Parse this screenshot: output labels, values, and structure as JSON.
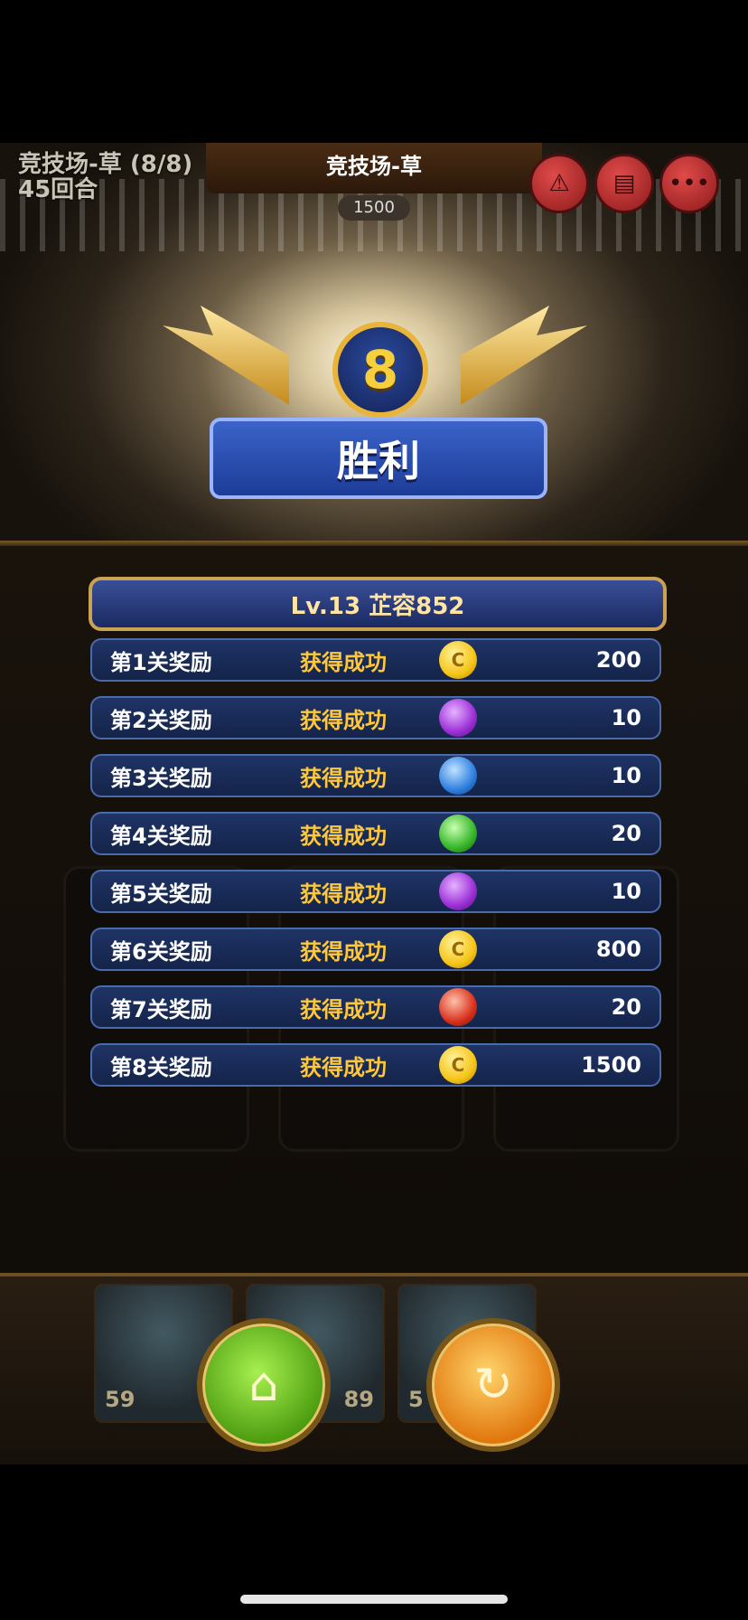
{
  "hud": {
    "stage_name": "竞技场-草 (8/8)",
    "rounds": "45回合",
    "title": "竞技场-草",
    "score": "1500",
    "buttons": [
      {
        "icon": "triangle-icon",
        "glyph": "⚠"
      },
      {
        "icon": "scroll-icon",
        "glyph": "▤"
      },
      {
        "icon": "more-icon",
        "glyph": "•••"
      }
    ]
  },
  "victory": {
    "rank": "8",
    "label": "胜利"
  },
  "result_panel": {
    "header": "Lv.13  芷容852",
    "rewards": [
      {
        "label": "第1关奖励",
        "status": "获得成功",
        "icon": "gold-coin-icon",
        "color": "#f5c518",
        "amount": "200"
      },
      {
        "label": "第2关奖励",
        "status": "获得成功",
        "icon": "purple-orb-icon",
        "color": "#9b2fd6",
        "amount": "10"
      },
      {
        "label": "第3关奖励",
        "status": "获得成功",
        "icon": "blue-drop-icon",
        "color": "#2f7fe0",
        "amount": "10"
      },
      {
        "label": "第4关奖励",
        "status": "获得成功",
        "icon": "green-orb-icon",
        "color": "#37b62a",
        "amount": "20"
      },
      {
        "label": "第5关奖励",
        "status": "获得成功",
        "icon": "purple-orb-icon",
        "color": "#9b2fd6",
        "amount": "10"
      },
      {
        "label": "第6关奖励",
        "status": "获得成功",
        "icon": "gold-coin-icon",
        "color": "#f5c518",
        "amount": "800"
      },
      {
        "label": "第7关奖励",
        "status": "获得成功",
        "icon": "red-orb-icon",
        "color": "#d8321e",
        "amount": "20"
      },
      {
        "label": "第8关奖励",
        "status": "获得成功",
        "icon": "gold-coin-icon",
        "color": "#f5c518",
        "amount": "1500"
      }
    ]
  },
  "bottom": {
    "hero_levels": [
      "59",
      "89",
      "5"
    ],
    "home_glyph": "⌂",
    "retry_glyph": "↻"
  },
  "colors": {
    "accent_gold": "#ffc83a",
    "ribbon_blue": "#3b63c9"
  }
}
